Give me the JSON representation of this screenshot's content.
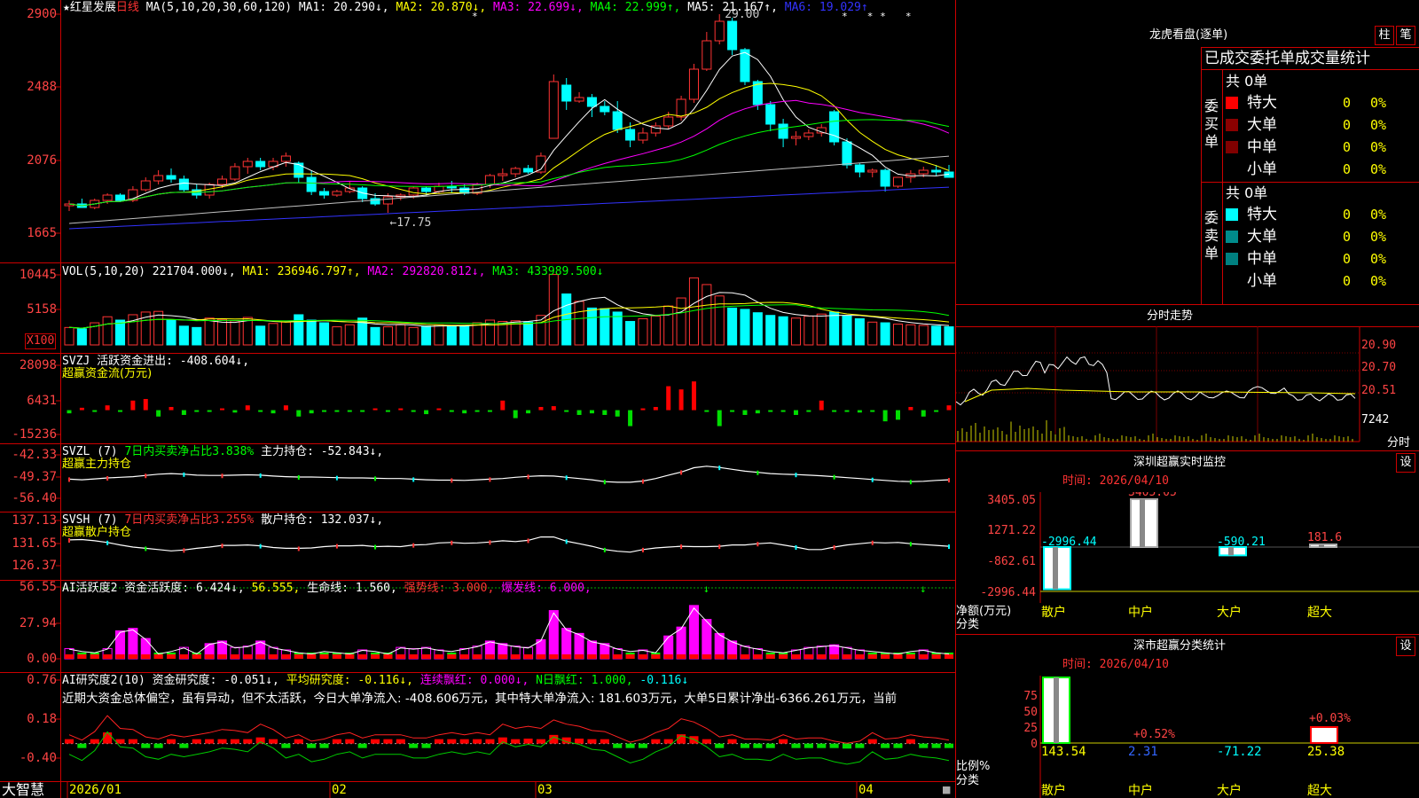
{
  "main": {
    "title_star": "★",
    "stock_name": "红星发展",
    "period": "日线",
    "ma_params": "MA(5,10,20,30,60,120)",
    "ma1": "MA1: 20.290↓,",
    "ma2": "MA2: 20.870↓,",
    "ma3": "MA3: 22.699↓,",
    "ma4": "MA4: 22.999↑,",
    "ma5": "MA5: 21.167↑,",
    "ma6": "MA6: 19.029↑",
    "yticks": [
      "2900",
      "2488",
      "2076",
      "1665"
    ],
    "high_label": "29.00",
    "low_label": "←17.75",
    "colors": {
      "ma1": "#ffffff",
      "ma2": "#ffff00",
      "ma3": "#ff00ff",
      "ma4": "#00ff00",
      "ma5": "#c0c0c0",
      "ma6": "#3333ff",
      "up": "#ff3333",
      "down": "#00ffff"
    }
  },
  "vol": {
    "title": "VOL(5,10,20)",
    "v": "221704.000↓,",
    "ma1": "MA1: 236946.797↑,",
    "ma2": "MA2: 292820.812↓,",
    "ma3": "MA3: 433989.500↓",
    "yticks": [
      "10445",
      "5158"
    ],
    "unit": "X100"
  },
  "svzj": {
    "title": "SVZJ  活跃资金进出: -408.604↓,",
    "subtitle": "超赢资金流(万元)",
    "yticks": [
      "28098",
      "6431",
      "-15236"
    ]
  },
  "svzl": {
    "title": "SVZL (7)",
    "t2": "7日内买卖净占比3.838%",
    "t3": "主力持仓: -52.843↓,",
    "subtitle": "超赢主力持仓",
    "yticks": [
      "-42.33",
      "-49.37",
      "-56.40"
    ]
  },
  "svsh": {
    "title": "SVSH (7)",
    "t2": "7日内买卖净占比3.255%",
    "t3": "散户持仓: 132.037↓,",
    "subtitle": "超赢散户持仓",
    "yticks": [
      "137.13",
      "131.65",
      "126.37"
    ]
  },
  "ai1": {
    "title": "AI活跃度2 资金活跃度: 6.424↓,",
    "t2": "56.555,",
    "t3": "生命线: 1.560,",
    "t4": "强势线: 3.000,",
    "t5": "爆发线: 6.000,",
    "yticks": [
      "56.55",
      "27.94",
      "0.00"
    ]
  },
  "ai2": {
    "title": "AI研究度2(10) 资金研究度: -0.051↓,",
    "t2": "平均研究度: -0.116↓,",
    "t3": "连续飘红: 0.000↓,",
    "t4": "N日飘红: 1.000,",
    "t5": "-0.116↓",
    "desc": "近期大资金总体偏空，虽有异动，但不太活跃，今日大单净流入: -408.606万元，其中特大单净流入: 181.603万元，大单5日累计净出-6366.261万元，当前",
    "yticks": [
      "0.76",
      "0.18",
      "-0.40"
    ]
  },
  "xaxis": {
    "logo": "大智慧",
    "labels": [
      "2026/01",
      "02",
      "03",
      "04"
    ]
  },
  "right": {
    "longhu_title": "龙虎看盘(逐单)",
    "btn1": "柱",
    "btn2": "笔",
    "stats_title": "已成交委托单成交量统计",
    "buy_label": "委买单",
    "sell_label": "委卖单",
    "buy_total": "共 0单",
    "sell_total": "共 0单",
    "buy_rows": [
      {
        "name": "特大",
        "count": "0",
        "pct": "0%",
        "color": "#ff0000"
      },
      {
        "name": "大单",
        "count": "0",
        "pct": "0%",
        "color": "#8b0000"
      },
      {
        "name": "中单",
        "count": "0",
        "pct": "0%",
        "color": "#800000"
      },
      {
        "name": "小单",
        "count": "0",
        "pct": "0%",
        "color": ""
      }
    ],
    "sell_rows": [
      {
        "name": "特大",
        "count": "0",
        "pct": "0%",
        "color": "#00ffff"
      },
      {
        "name": "大单",
        "count": "0",
        "pct": "0%",
        "color": "#008b8b"
      },
      {
        "name": "中单",
        "count": "0",
        "pct": "0%",
        "color": "#008080"
      },
      {
        "name": "小单",
        "count": "0",
        "pct": "0%",
        "color": ""
      }
    ],
    "intraday_title": "分时走势",
    "intraday_ticks": [
      "20.90",
      "20.70",
      "20.51",
      "7242"
    ],
    "intraday_unit": "分时",
    "sz_monitor_title": "深圳超赢实时监控",
    "set1": "设",
    "time1": "时间: 2026/04/10",
    "monitor_ticks": [
      "3405.05",
      "1271.22",
      "-862.61",
      "-2996.44"
    ],
    "monitor_axis_label": "净额(万元)",
    "monitor_cat_label": "分类",
    "monitor_cats": [
      "散户",
      "中户",
      "大户",
      "超大"
    ],
    "monitor_values": [
      "-2996.44",
      "3405.05",
      "-590.21",
      "181.6"
    ],
    "sz_class_title": "深市超赢分类统计",
    "set2": "设",
    "time2": "时间: 2026/04/10",
    "class_ticks": [
      "75",
      "50",
      "25",
      "0"
    ],
    "class_axis_label": "比例%",
    "class_cat_label": "分类",
    "class_cats": [
      "散户",
      "中户",
      "大户",
      "超大"
    ],
    "class_values": [
      "143.54",
      "2.31",
      "-71.22",
      "25.38"
    ],
    "class_pct_labels": [
      "+0.52%",
      "+0.03%"
    ]
  },
  "chart_data": [
    {
      "type": "candlestick",
      "title": "红星发展 日线",
      "ohlc": [
        [
          18.2,
          18.5,
          17.9,
          18.3
        ],
        [
          18.3,
          18.6,
          18.1,
          18.1
        ],
        [
          18.1,
          18.6,
          18.0,
          18.5
        ],
        [
          18.5,
          18.9,
          18.3,
          18.8
        ],
        [
          18.8,
          18.9,
          18.4,
          18.5
        ],
        [
          18.5,
          19.3,
          18.4,
          19.1
        ],
        [
          19.1,
          19.8,
          19.0,
          19.6
        ],
        [
          19.6,
          20.2,
          19.4,
          19.9
        ],
        [
          19.9,
          20.3,
          19.5,
          19.7
        ],
        [
          19.7,
          19.9,
          19.0,
          19.1
        ],
        [
          19.1,
          19.4,
          18.6,
          18.8
        ],
        [
          18.8,
          19.5,
          18.6,
          19.4
        ],
        [
          19.4,
          19.9,
          19.2,
          19.7
        ],
        [
          19.7,
          20.6,
          19.6,
          20.4
        ],
        [
          20.4,
          20.9,
          20.0,
          20.7
        ],
        [
          20.7,
          20.9,
          20.2,
          20.4
        ],
        [
          20.4,
          20.9,
          20.2,
          20.7
        ],
        [
          20.7,
          21.2,
          20.4,
          21.0
        ],
        [
          20.6,
          20.7,
          19.5,
          19.8
        ],
        [
          19.8,
          20.2,
          18.8,
          19.0
        ],
        [
          19.0,
          19.2,
          18.6,
          18.8
        ],
        [
          18.8,
          19.1,
          18.7,
          19.0
        ],
        [
          19.0,
          19.6,
          18.9,
          19.2
        ],
        [
          19.2,
          19.3,
          18.4,
          18.6
        ],
        [
          18.6,
          18.9,
          18.2,
          18.3
        ],
        [
          18.3,
          18.9,
          17.8,
          18.7
        ],
        [
          18.7,
          18.9,
          18.5,
          18.8
        ],
        [
          18.8,
          19.3,
          18.6,
          19.2
        ],
        [
          19.2,
          19.3,
          18.8,
          19.0
        ],
        [
          19.0,
          19.5,
          18.9,
          19.3
        ],
        [
          19.3,
          19.6,
          18.9,
          19.2
        ],
        [
          19.2,
          19.4,
          18.8,
          18.9
        ],
        [
          18.9,
          19.5,
          18.8,
          19.4
        ],
        [
          19.4,
          20.0,
          19.2,
          19.9
        ],
        [
          19.9,
          20.3,
          19.6,
          20.0
        ],
        [
          20.0,
          20.4,
          19.8,
          20.3
        ],
        [
          20.3,
          20.5,
          20.0,
          20.1
        ],
        [
          20.1,
          21.2,
          20.0,
          21.0
        ],
        [
          22.0,
          25.6,
          22.0,
          25.2
        ],
        [
          25.0,
          25.4,
          23.6,
          24.1
        ],
        [
          24.1,
          24.6,
          24.0,
          24.3
        ],
        [
          24.3,
          24.5,
          23.2,
          23.8
        ],
        [
          23.8,
          24.1,
          23.3,
          23.5
        ],
        [
          23.5,
          24.1,
          22.3,
          22.5
        ],
        [
          22.5,
          22.9,
          21.5,
          21.9
        ],
        [
          21.9,
          22.6,
          21.7,
          22.3
        ],
        [
          22.3,
          22.9,
          22.1,
          22.7
        ],
        [
          22.7,
          23.5,
          22.5,
          23.2
        ],
        [
          23.2,
          24.4,
          23.0,
          24.2
        ],
        [
          24.2,
          26.2,
          24.0,
          25.9
        ],
        [
          25.9,
          28.0,
          25.8,
          27.5
        ],
        [
          27.5,
          29.0,
          27.3,
          28.6
        ],
        [
          28.6,
          28.8,
          26.7,
          27.0
        ],
        [
          27.0,
          27.1,
          25.0,
          25.2
        ],
        [
          25.2,
          25.3,
          23.6,
          23.9
        ],
        [
          23.9,
          24.1,
          22.4,
          22.8
        ],
        [
          22.8,
          23.1,
          21.5,
          22.0
        ],
        [
          22.0,
          22.4,
          21.6,
          22.1
        ],
        [
          22.1,
          22.5,
          21.9,
          22.3
        ],
        [
          22.3,
          22.8,
          22.1,
          22.6
        ],
        [
          23.5,
          23.6,
          21.6,
          21.8
        ],
        [
          21.8,
          22.0,
          20.3,
          20.5
        ],
        [
          20.5,
          20.6,
          19.8,
          20.1
        ],
        [
          20.1,
          20.3,
          19.8,
          20.2
        ],
        [
          20.2,
          20.3,
          19.0,
          19.3
        ],
        [
          19.3,
          19.8,
          19.2,
          19.8
        ],
        [
          19.8,
          20.2,
          19.5,
          20.0
        ],
        [
          20.0,
          20.4,
          19.8,
          20.2
        ],
        [
          20.2,
          20.5,
          19.9,
          20.1
        ],
        [
          20.1,
          20.5,
          19.8,
          19.8
        ]
      ],
      "ylim": [
        16.65,
        29.0
      ],
      "high": 29.0,
      "low": 17.75
    },
    {
      "type": "bar",
      "title": "VOL(5,10,20)",
      "values": [
        2600,
        2400,
        3300,
        4200,
        3700,
        4500,
        4900,
        5000,
        3700,
        2800,
        2600,
        4000,
        3800,
        3600,
        4100,
        2800,
        3200,
        3400,
        4500,
        3700,
        3300,
        2700,
        3000,
        4000,
        2600,
        2700,
        3000,
        2600,
        2800,
        3000,
        2800,
        2900,
        3300,
        3700,
        3500,
        3600,
        3400,
        4400,
        10500,
        7600,
        6500,
        5500,
        5400,
        4900,
        3500,
        3900,
        4300,
        5800,
        7000,
        10000,
        9000,
        7300,
        5500,
        5300,
        4800,
        4400,
        4200,
        4000,
        4300,
        4600,
        4900,
        4300,
        3900,
        3400,
        3300,
        3100,
        3000,
        2900,
        2800,
        2700
      ],
      "ylim": [
        0,
        10445
      ]
    },
    {
      "type": "bar",
      "title": "超赢资金流(万元)",
      "values": [
        -2000,
        1500,
        -1000,
        3000,
        -500,
        6000,
        7000,
        -4000,
        2000,
        -3000,
        -1000,
        -1000,
        500,
        -1500,
        3000,
        -1000,
        -2000,
        3000,
        -4000,
        -2000,
        -500,
        -1000,
        -500,
        -500,
        500,
        -500,
        500,
        -1000,
        -2500,
        1000,
        -1000,
        -2000,
        -500,
        -1000,
        6000,
        -5000,
        -2000,
        2000,
        2500,
        -500,
        -3000,
        -2000,
        -3000,
        -4000,
        -10000,
        500,
        2000,
        15000,
        13000,
        18000,
        -500,
        -10000,
        -500,
        -3000,
        -2000,
        -500,
        -1000,
        -3000,
        -500,
        6000,
        -500,
        -500,
        -1500,
        -1000,
        -7000,
        -6000,
        2000,
        -4000,
        -1000,
        3000,
        -500,
        -500
      ],
      "ylim": [
        -15236,
        28098
      ]
    },
    {
      "type": "line",
      "title": "超赢主力持仓",
      "values": [
        -50.2,
        -50.4,
        -50.1,
        -49.8,
        -49.6,
        -49.4,
        -49.0,
        -48.6,
        -48.4,
        -48.6,
        -48.9,
        -49.0,
        -49.0,
        -48.9,
        -48.8,
        -48.9,
        -49.2,
        -49.4,
        -49.5,
        -49.5,
        -49.6,
        -49.7,
        -49.8,
        -49.8,
        -49.9,
        -50.0,
        -50.0,
        -50.2,
        -50.4,
        -50.5,
        -50.5,
        -50.6,
        -50.4,
        -50.2,
        -50.0,
        -49.6,
        -49.3,
        -49.1,
        -49.2,
        -49.6,
        -50.0,
        -50.4,
        -51.0,
        -51.2,
        -51.2,
        -50.8,
        -50.0,
        -48.9,
        -47.9,
        -46.5,
        -46.0,
        -46.4,
        -47.0,
        -47.6,
        -48.0,
        -48.4,
        -48.6,
        -48.7,
        -48.9,
        -49.1,
        -49.4,
        -49.7,
        -50.0,
        -50.3,
        -50.6,
        -50.9,
        -51.0,
        -50.9,
        -50.6,
        -50.4
      ],
      "ylim": [
        -56.4,
        -42.33
      ]
    },
    {
      "type": "line",
      "title": "超赢散户持仓",
      "values": [
        132.5,
        132.6,
        132.3,
        131.9,
        131.3,
        130.8,
        130.5,
        130.2,
        129.9,
        130.1,
        130.5,
        130.8,
        131.2,
        131.2,
        131.3,
        131.1,
        130.7,
        130.5,
        130.5,
        130.6,
        130.9,
        131.1,
        131.1,
        131.2,
        130.9,
        131.0,
        130.9,
        131.3,
        131.4,
        131.8,
        131.9,
        131.7,
        131.8,
        132.0,
        132.3,
        132.1,
        132.4,
        133.2,
        133.2,
        132.2,
        131.6,
        131.0,
        130.2,
        129.8,
        129.6,
        130.2,
        130.6,
        130.8,
        131.0,
        130.9,
        130.9,
        131.0,
        131.3,
        131.3,
        131.6,
        131.8,
        131.3,
        130.8,
        130.2,
        130.2,
        130.8,
        131.3,
        131.6,
        131.9,
        131.8,
        131.9,
        131.6,
        131.4,
        131.2,
        131.0
      ],
      "ylim": [
        126.37,
        137.13
      ]
    },
    {
      "type": "bar",
      "title": "AI活跃度2",
      "values": [
        8,
        6,
        5,
        8,
        22,
        24,
        16,
        4,
        6,
        9,
        4,
        12,
        14,
        9,
        10,
        14,
        9,
        7,
        5,
        4,
        6,
        5,
        4,
        7,
        6,
        4,
        9,
        8,
        9,
        7,
        6,
        8,
        10,
        14,
        12,
        10,
        9,
        15,
        38,
        24,
        20,
        14,
        12,
        8,
        6,
        7,
        5,
        18,
        25,
        42,
        31,
        20,
        14,
        10,
        8,
        6,
        5,
        7,
        9,
        10,
        11,
        9,
        7,
        6,
        5,
        4,
        6,
        7,
        5,
        4
      ],
      "ylim": [
        0,
        56.55
      ]
    },
    {
      "type": "bar",
      "title": "AI研究度2(10)",
      "values": [
        0.0,
        -0.05,
        0.03,
        0.18,
        0.06,
        0.05,
        -0.02,
        -0.04,
        0.0,
        -0.02,
        0.0,
        0.02,
        0.05,
        0.04,
        0.02,
        0.1,
        0.05,
        -0.03,
        0.0,
        -0.06,
        -0.04,
        0.0,
        0.02,
        -0.03,
        0.0,
        0.0,
        0.0,
        -0.03,
        -0.03,
        0.0,
        0.02,
        0.0,
        0.02,
        0.0,
        0.1,
        0.06,
        0.08,
        0.06,
        0.14,
        0.1,
        0.08,
        0.04,
        0.03,
        -0.02,
        -0.07,
        -0.04,
        0.02,
        0.06,
        0.15,
        0.12,
        0.06,
        -0.02,
        0.0,
        -0.04,
        -0.04,
        -0.05,
        0.0,
        -0.04,
        -0.03,
        -0.03,
        -0.06,
        -0.08,
        -0.06,
        0.02,
        -0.04,
        -0.03,
        0.0,
        -0.02,
        -0.03,
        -0.05
      ],
      "ylim": [
        -0.4,
        0.76
      ]
    },
    {
      "type": "bar",
      "title": "深圳超赢实时监控",
      "categories": [
        "散户",
        "中户",
        "大户",
        "超大"
      ],
      "values": [
        -2996.44,
        3405.05,
        -590.21,
        181.6
      ]
    },
    {
      "type": "bar",
      "title": "深市超赢分类统计",
      "categories": [
        "散户",
        "中户",
        "大户",
        "超大"
      ],
      "values": [
        143.54,
        2.31,
        -71.22,
        25.38
      ]
    }
  ]
}
